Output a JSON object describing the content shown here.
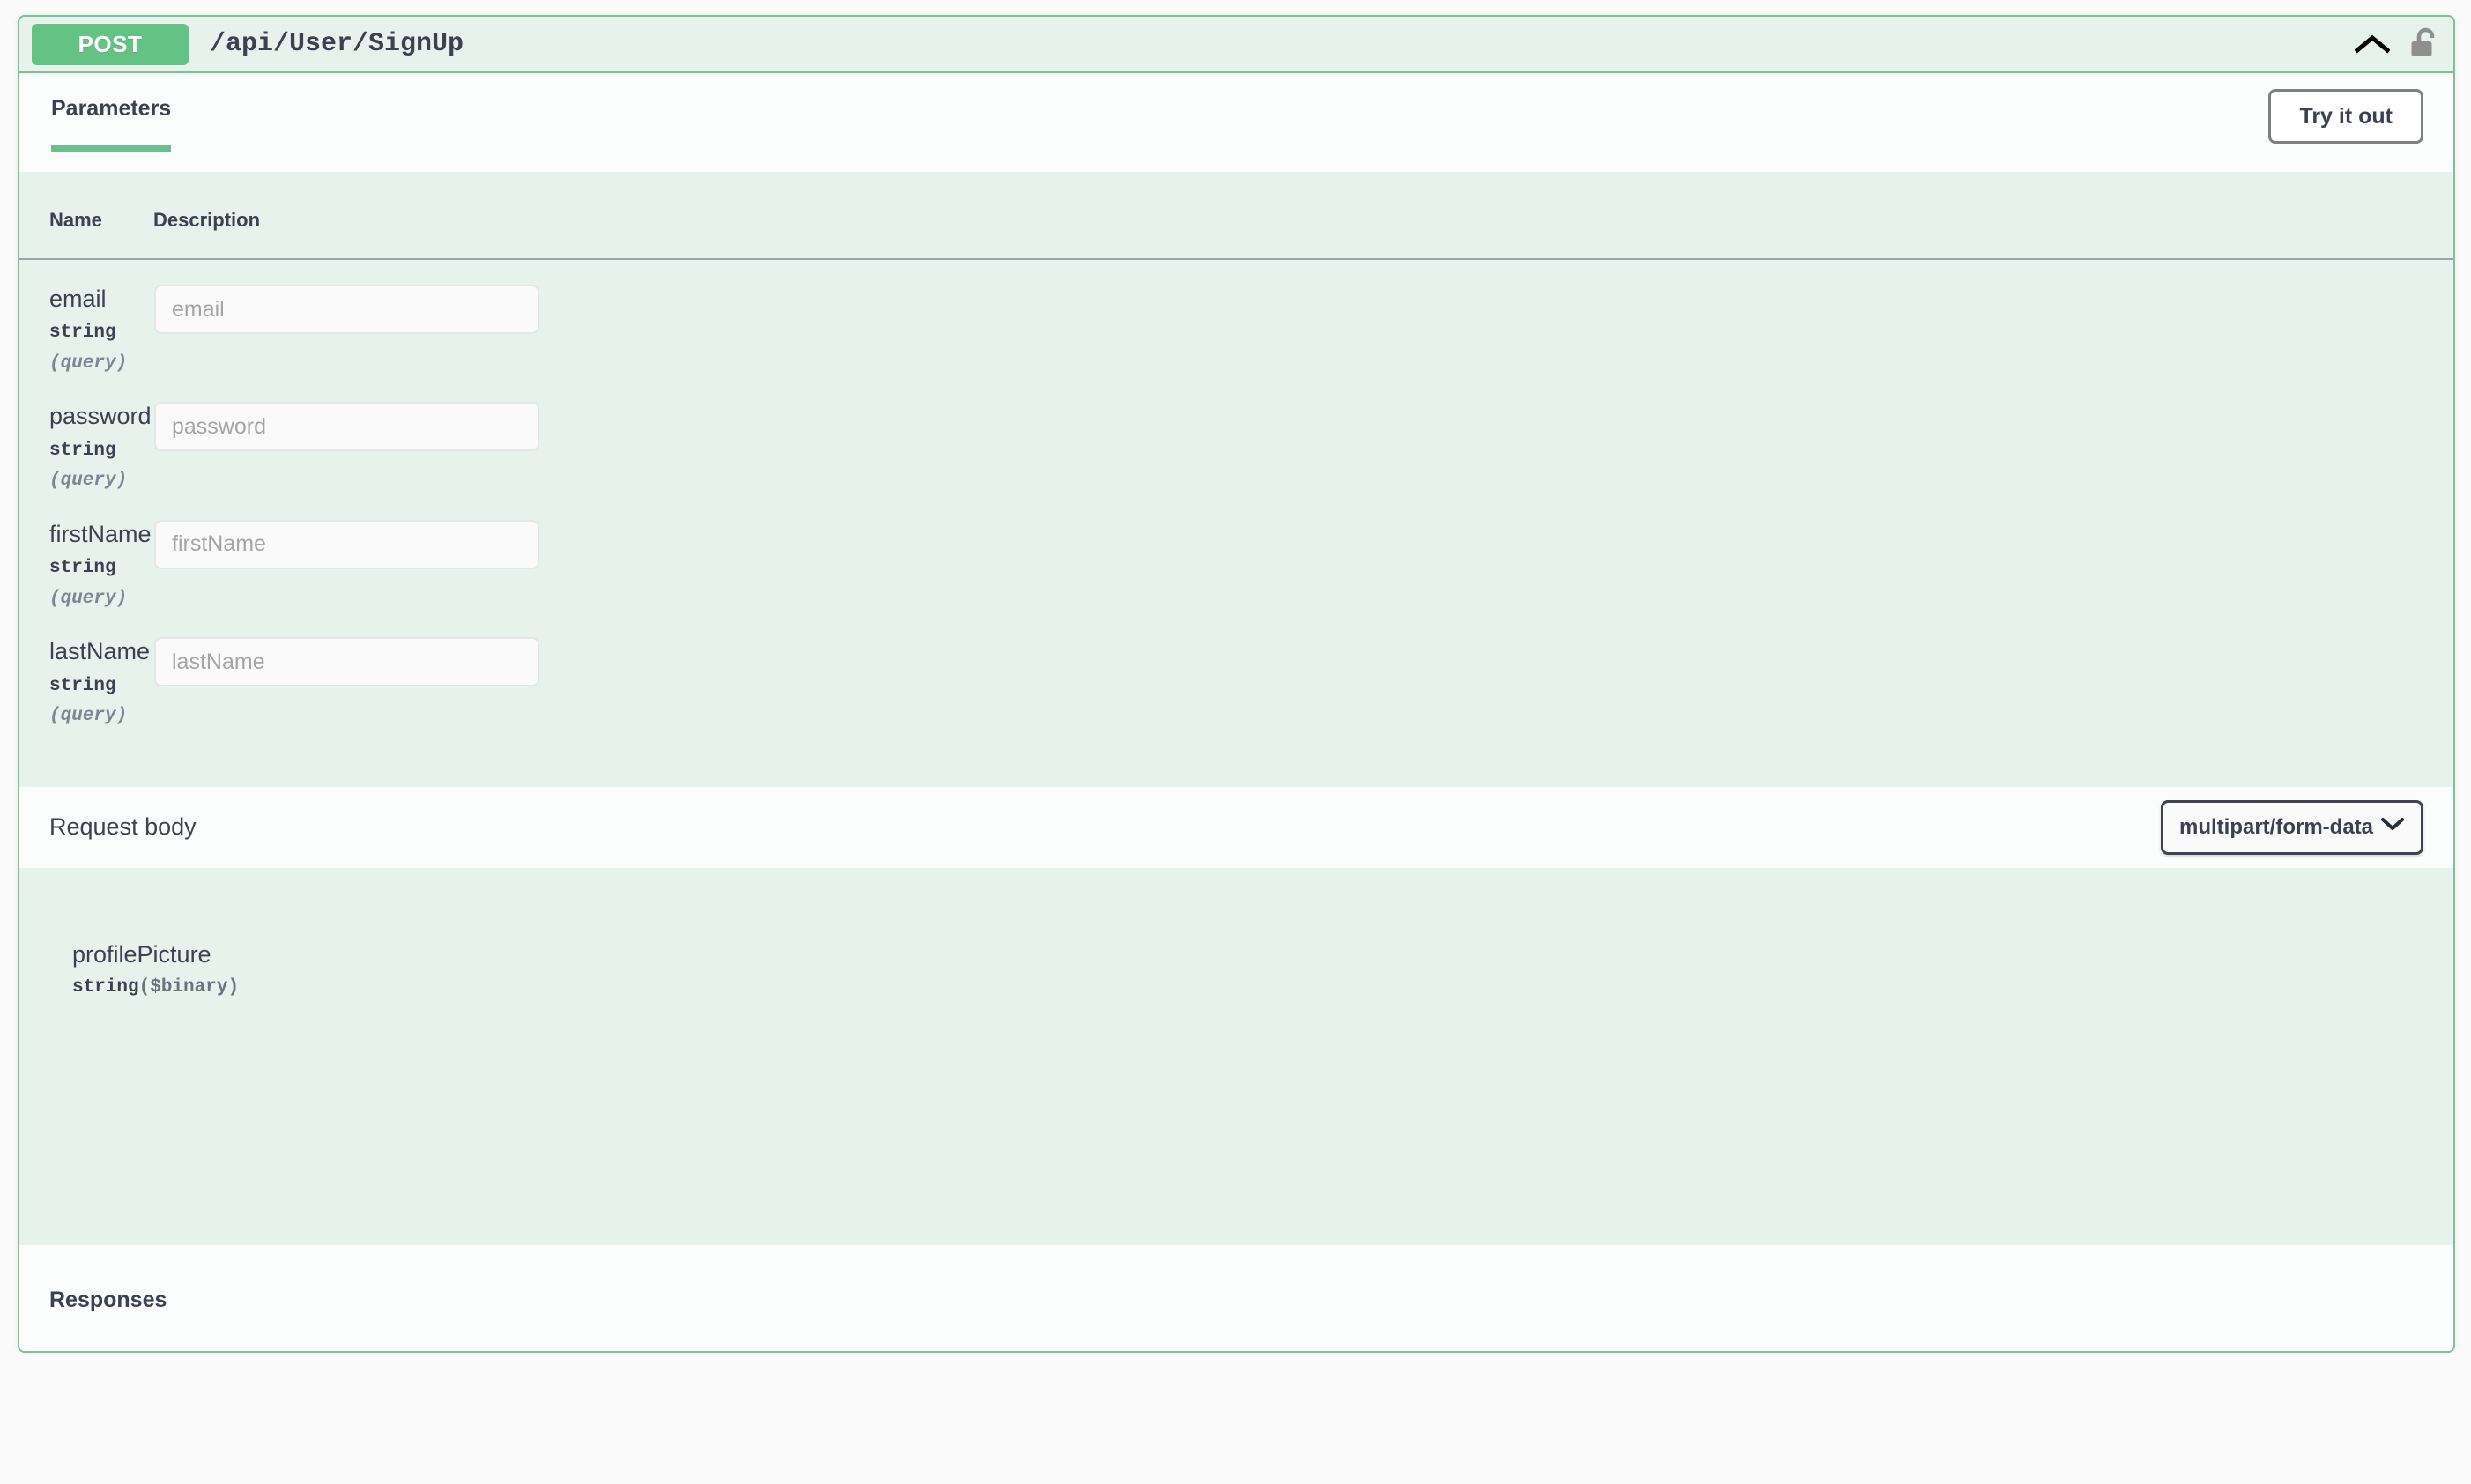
{
  "operation": {
    "method": "POST",
    "path": "/api/User/SignUp",
    "collapse_icon": "chevron-up-icon",
    "auth_icon": "unlocked-padlock-icon",
    "accent_green": "#63c284",
    "border_green": "#7fbf99",
    "section_tint": "#e8f2ec",
    "strip_white": "#fbfcfc"
  },
  "tabs": [
    {
      "label": "Parameters",
      "active": true
    }
  ],
  "try_it_out": {
    "label": "Try it out"
  },
  "parameters_table": {
    "columns": [
      "Name",
      "Description"
    ],
    "rows": [
      {
        "name": "email",
        "type": "string",
        "in": "(query)",
        "input_value": "",
        "input_placeholder": "email"
      },
      {
        "name": "password",
        "type": "string",
        "in": "(query)",
        "input_value": "",
        "input_placeholder": "password"
      },
      {
        "name": "firstName",
        "type": "string",
        "in": "(query)",
        "input_value": "",
        "input_placeholder": "firstName"
      },
      {
        "name": "lastName",
        "type": "string",
        "in": "(query)",
        "input_value": "",
        "input_placeholder": "lastName"
      }
    ]
  },
  "request_body": {
    "label": "Request body",
    "content_type_selected": "multipart/form-data",
    "content_type_options": [
      "multipart/form-data"
    ],
    "dropdown_icon": "chevron-down-icon",
    "properties": [
      {
        "name": "profilePicture",
        "type": "string",
        "format": "($binary)"
      }
    ]
  },
  "responses": {
    "title": "Responses"
  }
}
